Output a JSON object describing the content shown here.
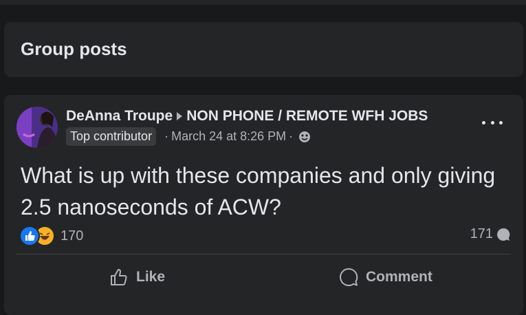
{
  "group_section": {
    "title": "Group posts"
  },
  "post": {
    "author": "DeAnna Troupe",
    "group": "NON PHONE / REMOTE WFH JOBS",
    "badge": "Top contributor",
    "separator": "·",
    "timestamp": "March 24 at 8:26 PM",
    "text": "What is up with these companies and only giving 2.5 nanoseconds of ACW?",
    "reaction_count": "170",
    "comment_count": "171",
    "reactions": [
      "like-icon",
      "haha-icon"
    ],
    "actions": {
      "like": "Like",
      "comment": "Comment"
    }
  },
  "colors": {
    "background": "#18191a",
    "card": "#242526",
    "primary_text": "#e4e6eb",
    "secondary_text": "#b0b3b8",
    "like_blue": "#1877f2",
    "haha_yellow": "#f7b125"
  }
}
